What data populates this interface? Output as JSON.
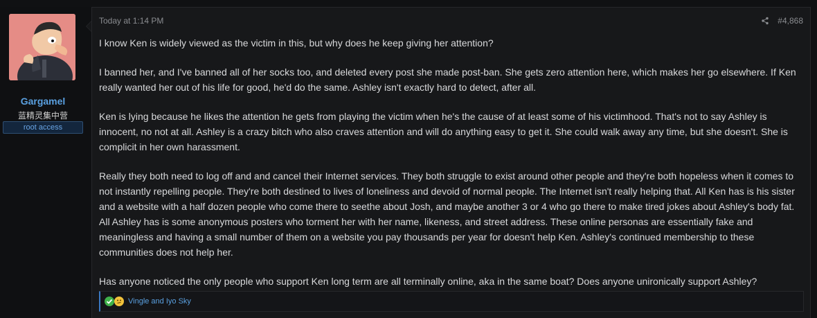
{
  "user": {
    "name": "Gargamel",
    "title": "蓝精灵集中营",
    "banner": "root access"
  },
  "post": {
    "date": "Today at 1:14 PM",
    "number": "#4,868",
    "paragraphs": [
      "I know Ken is widely viewed as the victim in this, but why does he keep giving her attention?",
      "I banned her, and I've banned all of her socks too, and deleted every post she made post-ban. She gets zero attention here, which makes her go elsewhere. If Ken really wanted her out of his life for good, he'd do the same. Ashley isn't exactly hard to detect, after all.",
      "Ken is lying because he likes the attention he gets from playing the victim when he's the cause of at least some of his victimhood. That's not to say Ashley is innocent, no not at all. Ashley is a crazy bitch who also craves attention and will do anything easy to get it. She could walk away any time, but she doesn't. She is complicit in her own harassment.",
      "Really they both need to log off and and cancel their Internet services. They both struggle to exist around other people and they're both hopeless when it comes to not instantly repelling people. They're both destined to lives of loneliness and devoid of normal people. The Internet isn't really helping that. All Ken has is his sister and a website with a half dozen people who come there to seethe about Josh, and maybe another 3 or 4 who go there to make tired jokes about Ashley's body fat. All Ashley has is some anonymous posters who torment her with her name, likeness, and street address. These online personas are essentially fake and meaningless and having a small number of them on a website you pay thousands per year for doesn't help Ken. Ashley's continued membership to these communities does not help her.",
      "Has anyone noticed the only people who support Ken long term are all terminally online, aka in the same boat? Does anyone unironically support Ashley?"
    ],
    "reactions": {
      "icons": [
        "like-icon",
        "thinking-icon"
      ],
      "text": "Vingle and Iyo Sky"
    }
  },
  "colors": {
    "accent": "#3a78c2",
    "username": "#5aa0e0",
    "background": "#17181a"
  }
}
